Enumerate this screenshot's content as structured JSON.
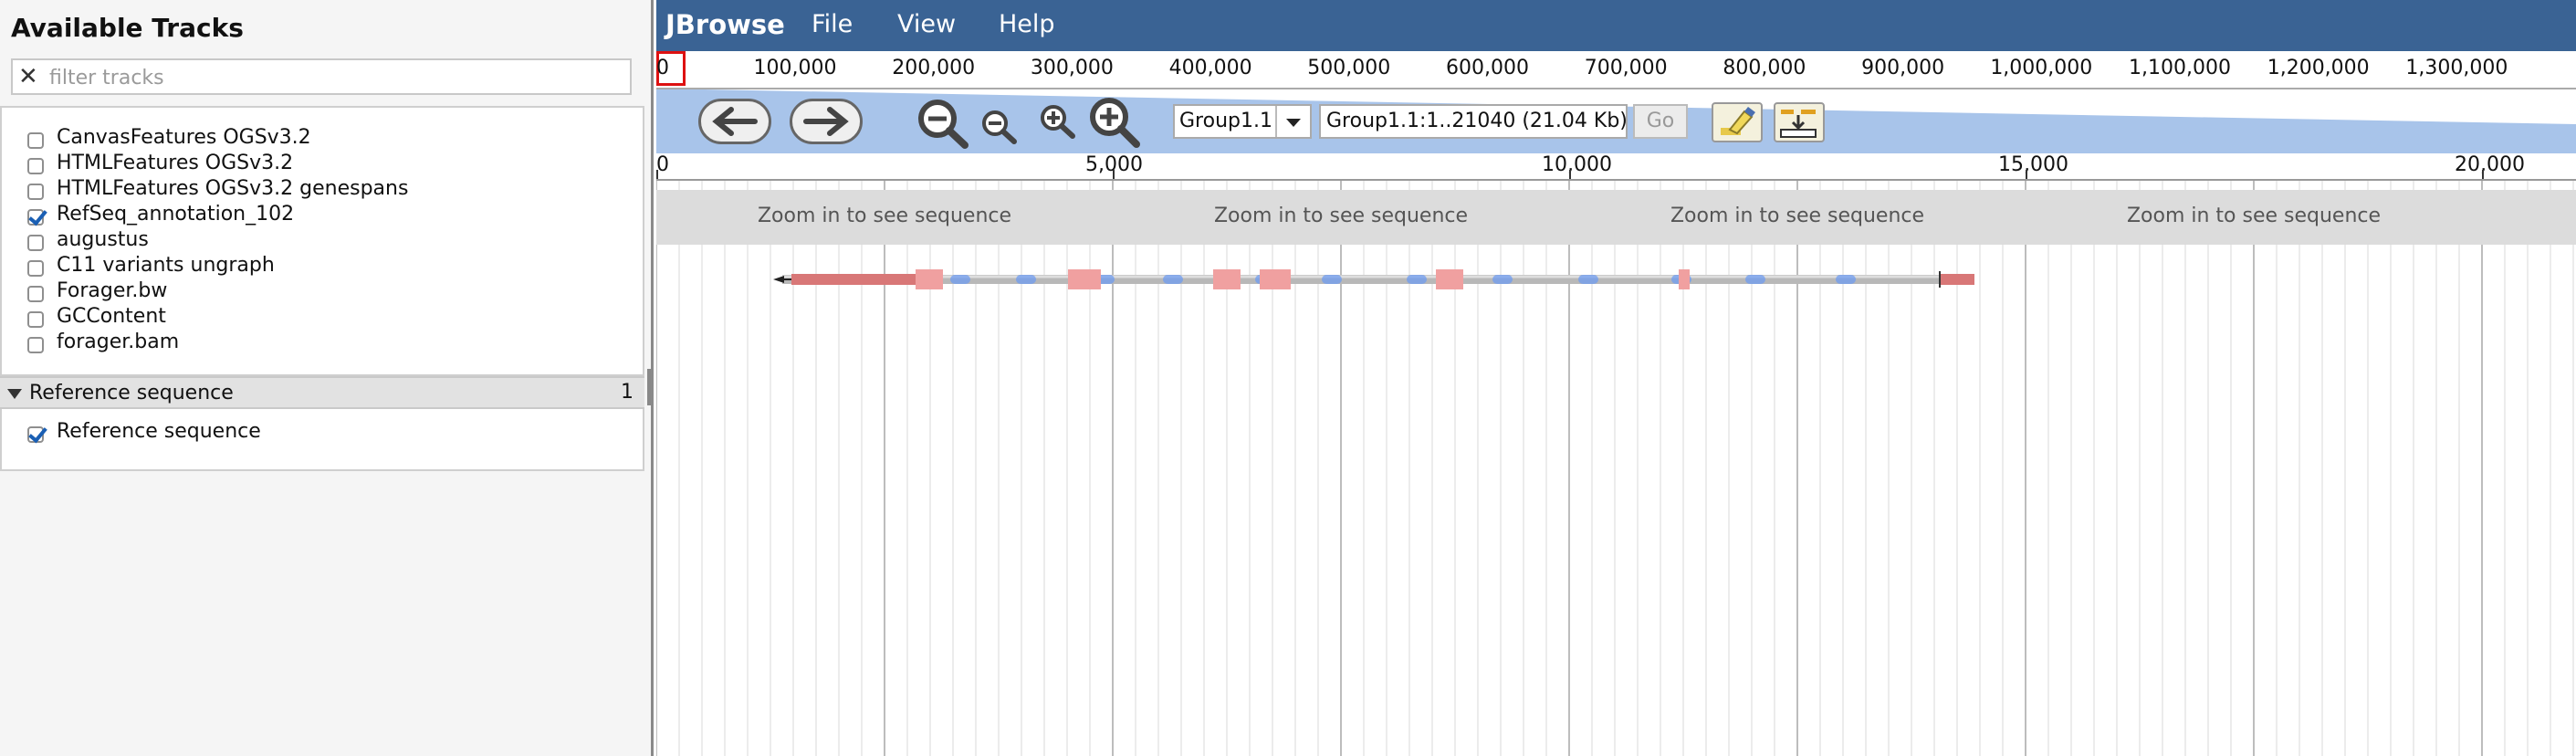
{
  "left_pane": {
    "title": "Available Tracks",
    "filter_placeholder": "filter tracks",
    "tracks": [
      {
        "label": "CanvasFeatures OGSv3.2",
        "checked": false
      },
      {
        "label": "HTMLFeatures OGSv3.2",
        "checked": false
      },
      {
        "label": "HTMLFeatures OGSv3.2 genespans",
        "checked": false
      },
      {
        "label": "RefSeq_annotation_102",
        "checked": true
      },
      {
        "label": "augustus",
        "checked": false
      },
      {
        "label": "C11 variants ungraph",
        "checked": false
      },
      {
        "label": "Forager.bw",
        "checked": false
      },
      {
        "label": "GCContent",
        "checked": false
      },
      {
        "label": "forager.bam",
        "checked": false
      }
    ],
    "category": {
      "label": "Reference sequence",
      "count": "1",
      "items": [
        {
          "label": "Reference sequence",
          "checked": true
        }
      ]
    }
  },
  "menubar": {
    "app_name": "JBrowse",
    "items": [
      "File",
      "View",
      "Help"
    ]
  },
  "overview": {
    "region_label": "0",
    "ticks": [
      "100,000",
      "200,000",
      "300,000",
      "400,000",
      "500,000",
      "600,000",
      "700,000",
      "800,000",
      "900,000",
      "1,000,000",
      "1,100,000",
      "1,200,000",
      "1,300,000"
    ]
  },
  "navbox": {
    "refseq": "Group1.1",
    "location": "Group1.1:1..21040 (21.04 Kb)",
    "go_label": "Go"
  },
  "detail": {
    "scale_ticks": [
      "0",
      "5,000",
      "10,000",
      "15,000",
      "20,000"
    ],
    "zoom_message": "Zoom in to see sequence",
    "colors": {
      "menubar": "#3a6394",
      "exon": "#f0a0a0",
      "utr": "#d87777",
      "intron_blue": "#6f9cf0"
    }
  }
}
